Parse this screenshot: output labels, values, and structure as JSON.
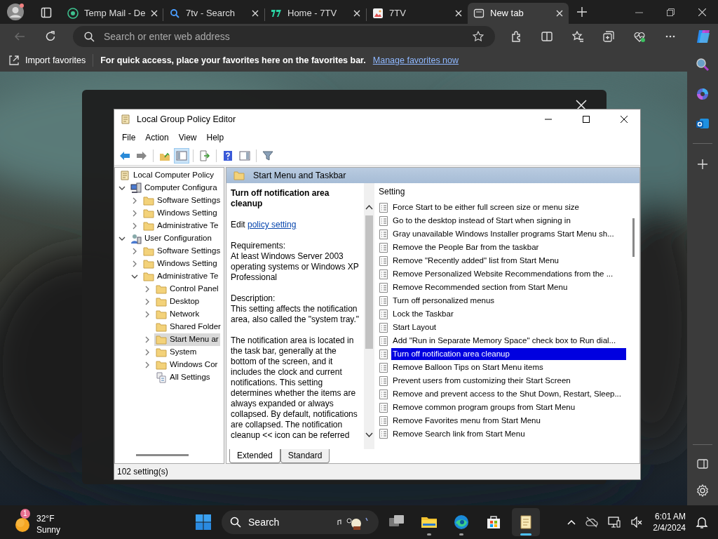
{
  "browser": {
    "tabs": [
      {
        "kind": "mail",
        "title": "Temp Mail - De",
        "selected": false
      },
      {
        "kind": "search",
        "title": "7tv - Search",
        "selected": false
      },
      {
        "kind": "logo",
        "title": "Home - 7TV",
        "selected": false
      },
      {
        "title": "7TV",
        "selected": false
      },
      {
        "kind": "newtab",
        "title": "New tab",
        "selected": true
      }
    ],
    "back": {
      "disabled": true
    },
    "address": {
      "placeholder": "Search or enter web address"
    },
    "favorites_bar": {
      "import_label": "Import favorites",
      "message": "For quick access, place your favorites here on the favorites bar.",
      "link": "Manage favorites now"
    }
  },
  "editor": {
    "title": "Local Group Policy Editor",
    "menu": [
      "File",
      "Action",
      "View",
      "Help"
    ],
    "toolbar": [
      {
        "kind": "back",
        "pressed": false
      },
      {
        "kind": "forward",
        "pressed": false
      },
      {
        "kind": "up",
        "pressed": false
      },
      {
        "kind": "tree",
        "pressed": true
      },
      {
        "kind": "export",
        "pressed": false
      },
      {
        "kind": "help",
        "pressed": false
      },
      {
        "kind": "pane",
        "pressed": false
      },
      {
        "kind": "filter",
        "pressed": false
      }
    ],
    "tree": [
      {
        "kind": "policy",
        "label": "Local Computer Policy",
        "expandable": false,
        "selected": false,
        "children": [
          {
            "kind": "computer",
            "label": "Computer Configura",
            "expandable": true,
            "expanded": true,
            "selected": false,
            "children": [
              {
                "kind": "folder",
                "label": "Software Settings",
                "expandable": true,
                "expanded": false,
                "selected": false
              },
              {
                "kind": "folder",
                "label": "Windows Setting",
                "expandable": true,
                "expanded": false,
                "selected": false
              },
              {
                "kind": "folder",
                "label": "Administrative Te",
                "expandable": true,
                "expanded": false,
                "selected": false
              }
            ]
          },
          {
            "kind": "user",
            "label": "User Configuration",
            "expandable": true,
            "expanded": true,
            "selected": false,
            "children": [
              {
                "kind": "folder",
                "label": "Software Settings",
                "expandable": true,
                "expanded": false,
                "selected": false
              },
              {
                "kind": "folder",
                "label": "Windows Setting",
                "expandable": true,
                "expanded": false,
                "selected": false
              },
              {
                "kind": "folder",
                "label": "Administrative Te",
                "expandable": true,
                "expanded": true,
                "selected": false,
                "children": [
                  {
                    "kind": "folder",
                    "label": "Control Panel",
                    "expandable": true,
                    "expanded": false,
                    "selected": false
                  },
                  {
                    "kind": "folder",
                    "label": "Desktop",
                    "expandable": true,
                    "expanded": false,
                    "selected": false
                  },
                  {
                    "kind": "folder",
                    "label": "Network",
                    "expandable": true,
                    "expanded": false,
                    "selected": false
                  },
                  {
                    "kind": "folder",
                    "label": "Shared Folder",
                    "expandable": false,
                    "selected": false
                  },
                  {
                    "kind": "folder",
                    "label": "Start Menu ar",
                    "expandable": true,
                    "expanded": false,
                    "selected": true
                  },
                  {
                    "kind": "folder",
                    "label": "System",
                    "expandable": true,
                    "expanded": false,
                    "selected": false
                  },
                  {
                    "kind": "folder",
                    "label": "Windows Cor",
                    "expandable": true,
                    "expanded": false,
                    "selected": false
                  },
                  {
                    "kind": "settings",
                    "label": "All Settings",
                    "expandable": false,
                    "selected": false
                  }
                ]
              }
            ]
          }
        ]
      }
    ],
    "header": "Start Menu and Taskbar",
    "policy_title": "Turn off notification area cleanup",
    "edit_prefix": "Edit",
    "edit_link": "policy setting",
    "paragraphs": [
      "Requirements:\nAt least Windows Server 2003 operating systems or Windows XP Professional",
      "Description:\nThis setting affects the notification area, also called the \"system tray.\"",
      "The notification area is located in the task bar, generally at the bottom of the screen, and it includes the clock and current notifications. This setting determines whether the items are always expanded or always collapsed. By default, notifications are collapsed. The notification cleanup << icon can be referred"
    ],
    "column_header": "Setting",
    "settings": [
      {
        "name": "Force Start to be either full screen size or menu size",
        "selected": false
      },
      {
        "name": "Go to the desktop instead of Start when signing in",
        "selected": false
      },
      {
        "name": "Gray unavailable Windows Installer programs Start Menu sh...",
        "selected": false
      },
      {
        "name": "Remove the People Bar from the taskbar",
        "selected": false
      },
      {
        "name": "Remove \"Recently added\" list from Start Menu",
        "selected": false
      },
      {
        "name": "Remove Personalized Website Recommendations from the ...",
        "selected": false
      },
      {
        "name": "Remove Recommended section from Start Menu",
        "selected": false
      },
      {
        "name": "Turn off personalized menus",
        "selected": false
      },
      {
        "name": "Lock the Taskbar",
        "selected": false
      },
      {
        "name": "Start Layout",
        "selected": false
      },
      {
        "name": "Add \"Run in Separate Memory Space\" check box to Run dial...",
        "selected": false
      },
      {
        "name": "Turn off notification area cleanup",
        "selected": true
      },
      {
        "name": "Remove Balloon Tips on Start Menu items",
        "selected": false
      },
      {
        "name": "Prevent users from customizing their Start Screen",
        "selected": false
      },
      {
        "name": "Remove and prevent access to the Shut Down, Restart, Sleep...",
        "selected": false
      },
      {
        "name": "Remove common program groups from Start Menu",
        "selected": false
      },
      {
        "name": "Remove Favorites menu from Start Menu",
        "selected": false
      },
      {
        "name": "Remove Search link from Start Menu",
        "selected": false
      }
    ],
    "view_tabs": [
      {
        "label": "Extended",
        "selected": true
      },
      {
        "label": "Standard",
        "selected": false
      }
    ],
    "status": "102 setting(s)"
  },
  "taskbar": {
    "weather": {
      "badge": "1",
      "temperature": "32°F",
      "condition": "Sunny"
    },
    "search_label": "Search",
    "apps": [
      {
        "kind": "taskview",
        "running": false,
        "active": false
      },
      {
        "kind": "explorer",
        "running": true,
        "active": false
      },
      {
        "kind": "edge",
        "running": true,
        "active": false
      },
      {
        "kind": "store",
        "running": false,
        "active": false
      },
      {
        "kind": "notepad",
        "running": true,
        "active": true
      }
    ],
    "time": "6:01 AM",
    "date": "2/4/2024"
  }
}
